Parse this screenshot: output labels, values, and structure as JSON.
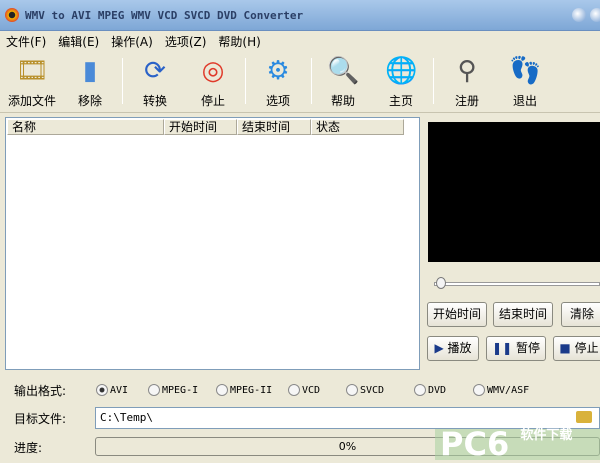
{
  "title": "WMV to AVI MPEG WMV VCD SVCD DVD Converter",
  "menu": [
    "文件(F)",
    "编辑(E)",
    "操作(A)",
    "选项(Z)",
    "帮助(H)"
  ],
  "toolbar": [
    {
      "label": "添加文件",
      "icon": "add-file-icon"
    },
    {
      "label": "移除",
      "icon": "remove-icon"
    },
    {
      "label": "转换",
      "icon": "convert-icon"
    },
    {
      "label": "停止",
      "icon": "stop-lifebuoy-icon"
    },
    {
      "label": "选项",
      "icon": "gear-icon"
    },
    {
      "label": "帮助",
      "icon": "help-icon"
    },
    {
      "label": "主页",
      "icon": "home-globe-icon"
    },
    {
      "label": "注册",
      "icon": "key-icon"
    },
    {
      "label": "退出",
      "icon": "exit-footprints-icon"
    }
  ],
  "columns": [
    "名称",
    "开始时间",
    "结束时间",
    "状态"
  ],
  "player": {
    "start_time": "开始时间",
    "end_time": "结束时间",
    "clear": "清除",
    "play": "播放",
    "pause": "暂停",
    "stop": "停止",
    "position": 0
  },
  "output": {
    "label": "输出格式:",
    "formats": [
      "AVI",
      "MPEG-I",
      "MPEG-II",
      "VCD",
      "SVCD",
      "DVD",
      "WMV/ASF"
    ],
    "selected": "AVI"
  },
  "target": {
    "label": "目标文件:",
    "value": "C:\\Temp\\"
  },
  "progress": {
    "label": "进度:",
    "value": "0%"
  },
  "watermark": {
    "main": "PC6",
    "sub": "软件下载"
  }
}
